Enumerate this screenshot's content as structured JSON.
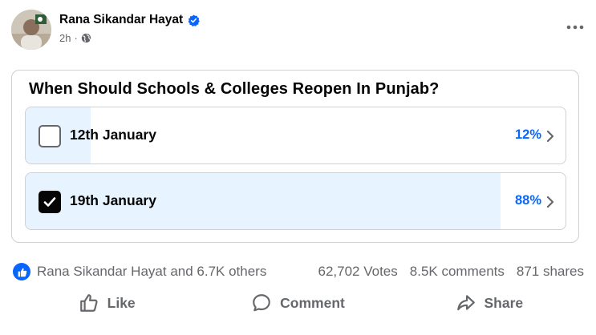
{
  "post": {
    "author": "Rana Sikandar Hayat",
    "time": "2h",
    "separator": "·"
  },
  "poll": {
    "question": "When Should Schools & Colleges Reopen In Punjab?",
    "options": [
      {
        "label": "12th January",
        "percent_text": "12%",
        "percent": 12,
        "checked": false
      },
      {
        "label": "19th January",
        "percent_text": "88%",
        "percent": 88,
        "checked": true
      }
    ]
  },
  "stats": {
    "reactors": "Rana Sikandar Hayat and 6.7K others",
    "votes": "62,702 Votes",
    "comments": "8.5K comments",
    "shares": "871 shares"
  },
  "actions": {
    "like": "Like",
    "comment": "Comment",
    "share": "Share"
  },
  "colors": {
    "accent": "#0866ff",
    "fill": "#e7f3ff",
    "muted": "#65676b"
  },
  "icons": {
    "verified": "verified-badge-icon",
    "globe": "globe-icon",
    "more": "more-dots-icon",
    "like_reaction": "thumbs-up-icon",
    "chevron": "chevron-right-icon",
    "like": "like-icon",
    "comment": "comment-icon",
    "share": "share-icon"
  }
}
